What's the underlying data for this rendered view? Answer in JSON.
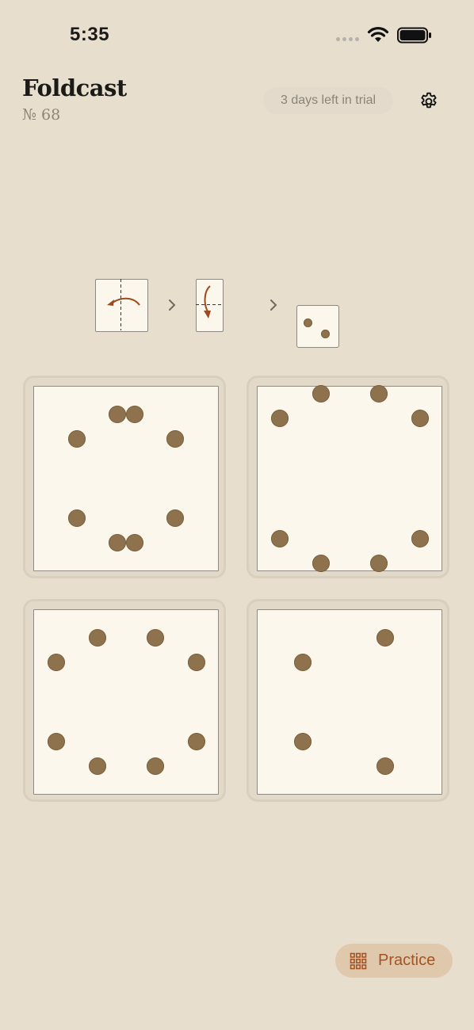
{
  "status_bar": {
    "time": "5:35"
  },
  "header": {
    "title": "Foldcast",
    "puzzle_number": "№ 68",
    "trial_text": "3 days left in trial"
  },
  "fold_sequence": {
    "steps": [
      {
        "fold": "vertical",
        "direction": "right-to-left"
      },
      {
        "fold": "horizontal",
        "direction": "top-to-bottom"
      }
    ],
    "result_holes": 2
  },
  "options": [
    {
      "id": "a",
      "holes": 8
    },
    {
      "id": "b",
      "holes": 8
    },
    {
      "id": "c",
      "holes": 8
    },
    {
      "id": "d",
      "holes": 4
    }
  ],
  "practice_button": {
    "label": "Practice"
  },
  "colors": {
    "background": "#e7dece",
    "paper": "#fcf7ec",
    "hole": "#8e724e",
    "accent": "#a45324",
    "practice_bg": "#e0c8ad"
  },
  "icons": [
    "wifi-icon",
    "battery-icon",
    "gear-icon",
    "grid-icon",
    "chevron-right-icon",
    "fold-arrow-icon"
  ]
}
